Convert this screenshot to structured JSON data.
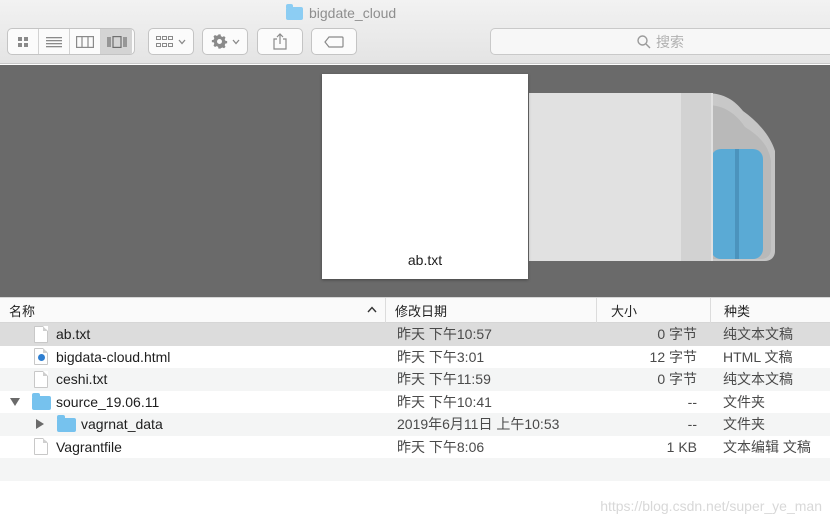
{
  "window": {
    "title": "bigdate_cloud"
  },
  "toolbar": {
    "view_modes": [
      "icon-view-icon",
      "list-view-icon",
      "column-view-icon",
      "cover-flow-icon"
    ],
    "active_view": "cover-flow-icon",
    "group_icon": "group-grid-icon",
    "action_icon": "gear-icon",
    "share_icon": "share-icon",
    "tag_icon": "tag-icon"
  },
  "search": {
    "placeholder": "搜索",
    "icon": "search-icon"
  },
  "preview": {
    "filename": "ab.txt"
  },
  "columns": {
    "name": "名称",
    "date": "修改日期",
    "size": "大小",
    "kind": "种类"
  },
  "files": [
    {
      "name": "ab.txt",
      "date": "昨天 下午10:57",
      "size": "0 字节",
      "kind": "纯文本文稿",
      "icon": "text-file-icon"
    },
    {
      "name": "bigdata-cloud.html",
      "date": "昨天 下午3:01",
      "size": "12 字节",
      "kind": "HTML 文稿",
      "icon": "html-file-icon"
    },
    {
      "name": "ceshi.txt",
      "date": "昨天 下午11:59",
      "size": "0 字节",
      "kind": "纯文本文稿",
      "icon": "text-file-icon"
    },
    {
      "name": "source_19.06.11",
      "date": "昨天 下午10:41",
      "size": "--",
      "kind": "文件夹",
      "icon": "folder-icon"
    },
    {
      "name": "vagrnat_data",
      "date": "2019年6月11日 上午10:53",
      "size": "--",
      "kind": "文件夹",
      "icon": "folder-icon"
    },
    {
      "name": "Vagrantfile",
      "date": "昨天 下午8:06",
      "size": "1 KB",
      "kind": "文本编辑 文稿",
      "icon": "text-file-icon"
    }
  ],
  "watermark": "https://blog.csdn.net/super_ye_man",
  "colors": {
    "preview_bg": "#6a6a6a",
    "selected_row": "#dcdcdc",
    "folder": "#76c2ee",
    "toolbar": "#ececec"
  }
}
